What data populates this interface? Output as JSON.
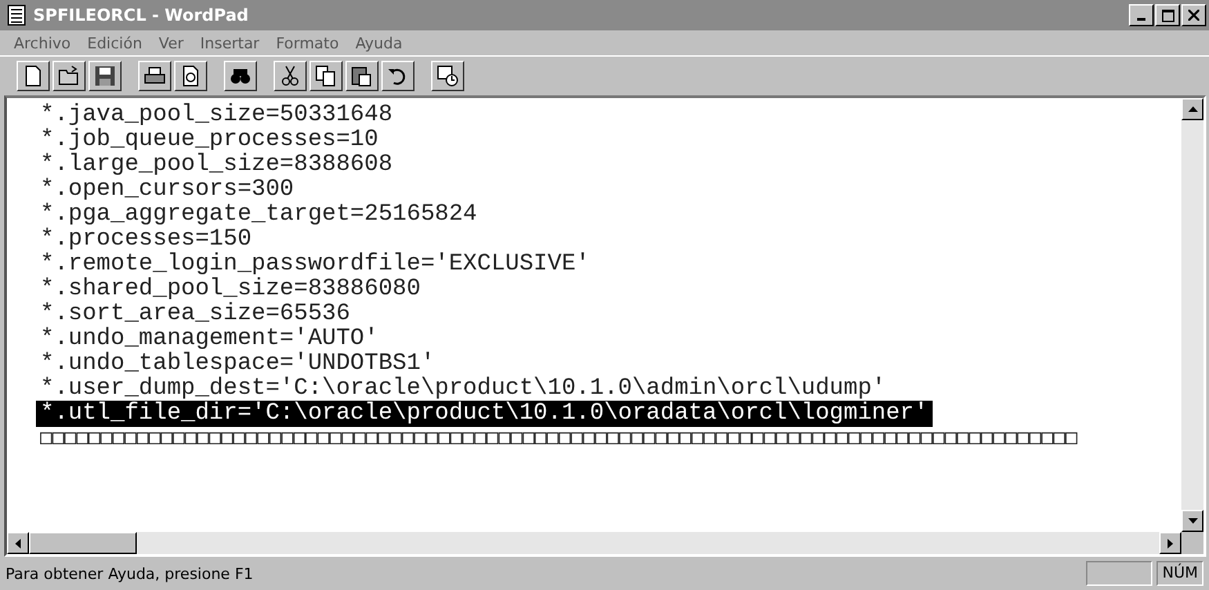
{
  "window": {
    "title": "SPFILEORCL - WordPad"
  },
  "menu": [
    "Archivo",
    "Edición",
    "Ver",
    "Insertar",
    "Formato",
    "Ayuda"
  ],
  "toolbar": [
    {
      "kind": "new"
    },
    {
      "kind": "open"
    },
    {
      "kind": "save"
    },
    {
      "kind": "sep"
    },
    {
      "kind": "print"
    },
    {
      "kind": "preview"
    },
    {
      "kind": "sep"
    },
    {
      "kind": "find"
    },
    {
      "kind": "sep"
    },
    {
      "kind": "cut"
    },
    {
      "kind": "copy"
    },
    {
      "kind": "paste"
    },
    {
      "kind": "undo"
    },
    {
      "kind": "sep"
    },
    {
      "kind": "datetime"
    }
  ],
  "document": {
    "lines": [
      {
        "text": "*.java_pool_size=50331648",
        "selected": false
      },
      {
        "text": "*.job_queue_processes=10",
        "selected": false
      },
      {
        "text": "*.large_pool_size=8388608",
        "selected": false
      },
      {
        "text": "*.open_cursors=300",
        "selected": false
      },
      {
        "text": "*.pga_aggregate_target=25165824",
        "selected": false
      },
      {
        "text": "*.processes=150",
        "selected": false
      },
      {
        "text": "*.remote_login_passwordfile='EXCLUSIVE'",
        "selected": false
      },
      {
        "text": "*.shared_pool_size=83886080",
        "selected": false
      },
      {
        "text": "*.sort_area_size=65536",
        "selected": false
      },
      {
        "text": "*.undo_management='AUTO'",
        "selected": false
      },
      {
        "text": "*.undo_tablespace='UNDOTBS1'",
        "selected": false
      },
      {
        "text": "*.user_dump_dest='C:\\oracle\\product\\10.1.0\\admin\\orcl\\udump'",
        "selected": false
      },
      {
        "text": "*.utl_file_dir='C:\\oracle\\product\\10.1.0\\oradata\\orcl\\logminer'",
        "selected": true
      },
      {
        "text": "□□□□□□□□□□□□□□□□□□□□□□□□□□□□□□□□□□□□□□□□□□□□□□□□□□□□□□□□□□□□□□□□□□□□□□□□□□□□□□□□□□□□□□",
        "selected": false,
        "kind": "glyphs"
      }
    ]
  },
  "status_bar": {
    "message": "Para obtener Ayuda, presione F1",
    "indicator": "NÚM"
  }
}
